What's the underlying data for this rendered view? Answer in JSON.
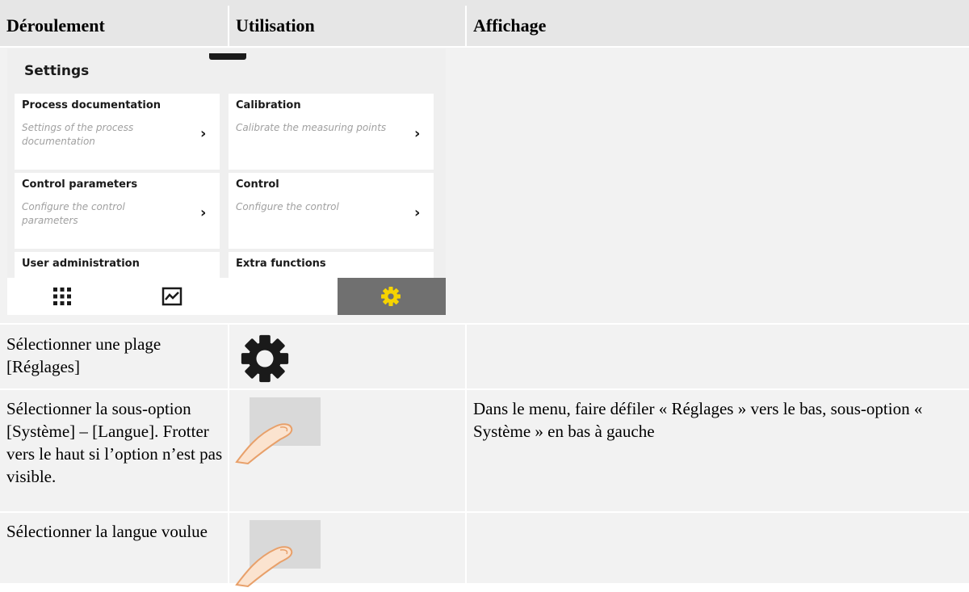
{
  "header": {
    "col1": "Déroulement",
    "col2": "Utilisation",
    "col3": "Affichage"
  },
  "device": {
    "title": "Settings",
    "tiles": [
      {
        "title": "Process documentation",
        "desc": "Settings of the process documentation"
      },
      {
        "title": "Calibration",
        "desc": "Calibrate the measuring points"
      },
      {
        "title": "Control parameters",
        "desc": "Configure the control parameters"
      },
      {
        "title": "Control",
        "desc": "Configure the control"
      },
      {
        "title": "User administration",
        "desc": ""
      },
      {
        "title": "Extra functions",
        "desc": ""
      }
    ],
    "nav": {
      "active": "settings",
      "accent": "#f5d300"
    }
  },
  "rows": [
    {
      "step": "Sélectionner une plage [Réglages]",
      "usage_icon": "gear-icon",
      "display": ""
    },
    {
      "step": "Sélectionner la sous-option [Système] – [Langue]. Frotter vers le haut si l’option n’est pas visible.",
      "usage_icon": "swipe-gesture-icon",
      "display": "Dans le menu, faire défiler « Réglages » vers le bas, sous-option « Système » en bas à gauche"
    },
    {
      "step": "Sélectionner la langue voulue",
      "usage_icon": "swipe-gesture-icon",
      "display": ""
    }
  ]
}
